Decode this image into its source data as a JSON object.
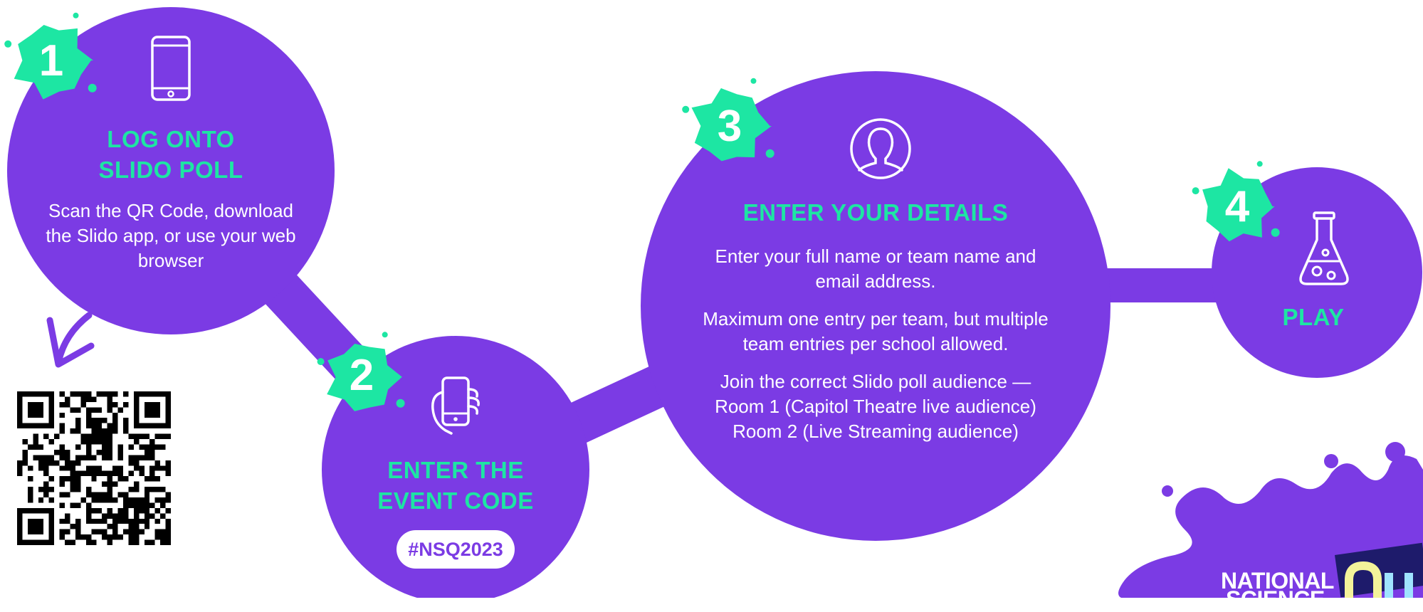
{
  "colors": {
    "purple": "#7b3be4",
    "green": "#1de6a3",
    "white": "#ffffff",
    "navy": "#1e1b6b"
  },
  "step1": {
    "number": "1",
    "icon": "smartphone-icon",
    "title_line1": "LOG ONTO",
    "title_line2": "SLIDO POLL",
    "body": "Scan the QR Code, download the Slido app, or use your web browser"
  },
  "qr": {
    "icon": "qr-code"
  },
  "step2": {
    "number": "2",
    "icon": "hand-holding-phone-icon",
    "title_line1": "ENTER THE",
    "title_line2": "EVENT CODE",
    "code": "#NSQ2023"
  },
  "step3": {
    "number": "3",
    "icon": "user-profile-icon",
    "title": "ENTER YOUR DETAILS",
    "para1": "Enter your full name or team name and email address.",
    "para2": "Maximum one entry per team, but multiple team entries per school allowed.",
    "para3_line1": "Join the correct Slido poll audience —",
    "para3_line2": "Room 1 (Capitol Theatre live audience)",
    "para3_line3": "Room 2 (Live Streaming audience)"
  },
  "step4": {
    "number": "4",
    "icon": "flask-icon",
    "title": "PLAY"
  },
  "brand": {
    "line1": "NATIONAL",
    "line2": "SCIENCE"
  }
}
